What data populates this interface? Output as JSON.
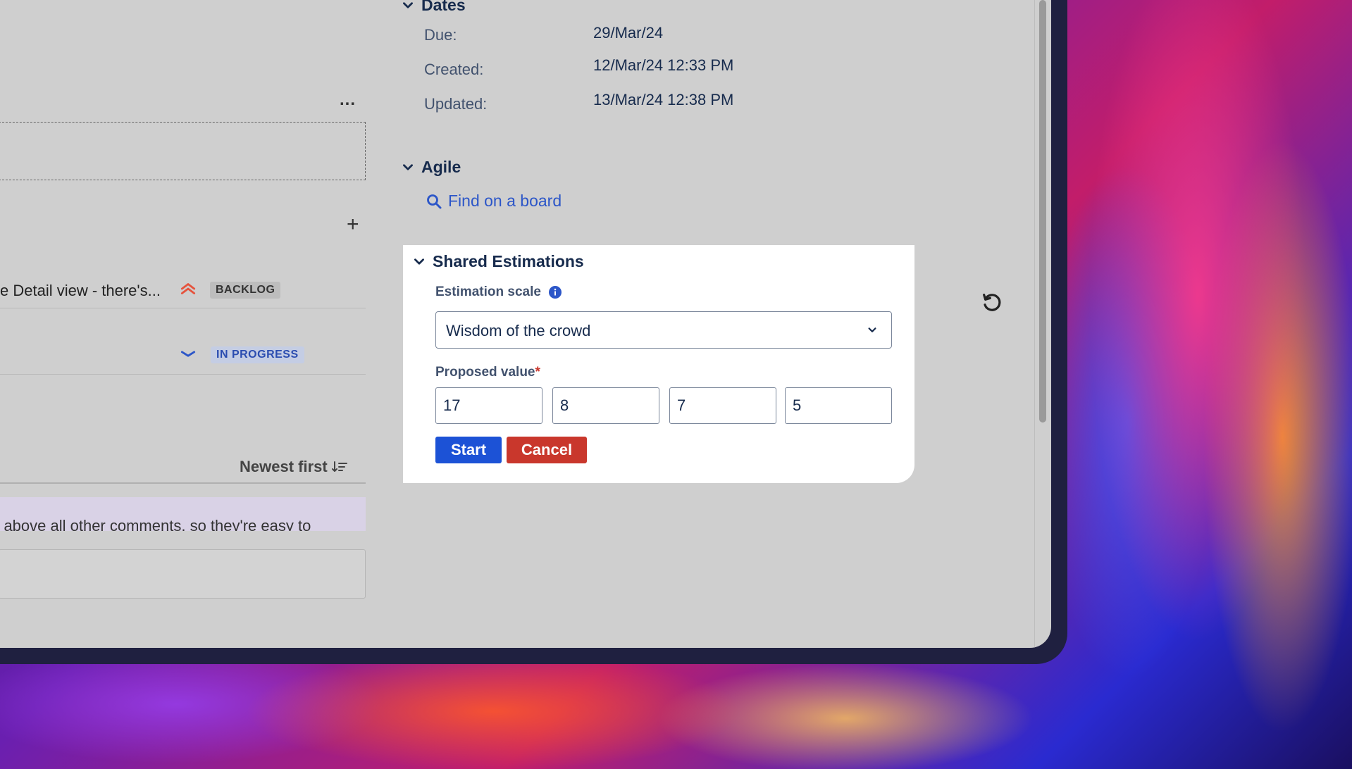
{
  "left_panel": {
    "more_label": "...",
    "add_label": "+",
    "issues": [
      {
        "summary": "e Detail view - there's...",
        "status": "BACKLOG",
        "priority_icon": "priority-highest-icon"
      },
      {
        "summary": "",
        "status": "IN PROGRESS",
        "priority_icon": "priority-low-icon"
      }
    ],
    "sort_label": "Newest first",
    "pinned_text": "r above all other comments, so they're easy to"
  },
  "dates": {
    "title": "Dates",
    "fields": [
      {
        "label": "Due:",
        "value": "29/Mar/24"
      },
      {
        "label": "Created:",
        "value": "12/Mar/24 12:33 PM"
      },
      {
        "label": "Updated:",
        "value": "13/Mar/24 12:38 PM"
      }
    ]
  },
  "agile": {
    "title": "Agile",
    "find_link": "Find on a board"
  },
  "estimations": {
    "title": "Shared Estimations",
    "scale_label": "Estimation scale",
    "scale_value": "Wisdom of the crowd",
    "proposed_label": "Proposed value",
    "required_mark": "*",
    "values": [
      "17",
      "8",
      "7",
      "5"
    ],
    "start_label": "Start",
    "cancel_label": "Cancel"
  },
  "colors": {
    "primary": "#1c52d6",
    "danger": "#c9372c",
    "link": "#2c56c8"
  }
}
